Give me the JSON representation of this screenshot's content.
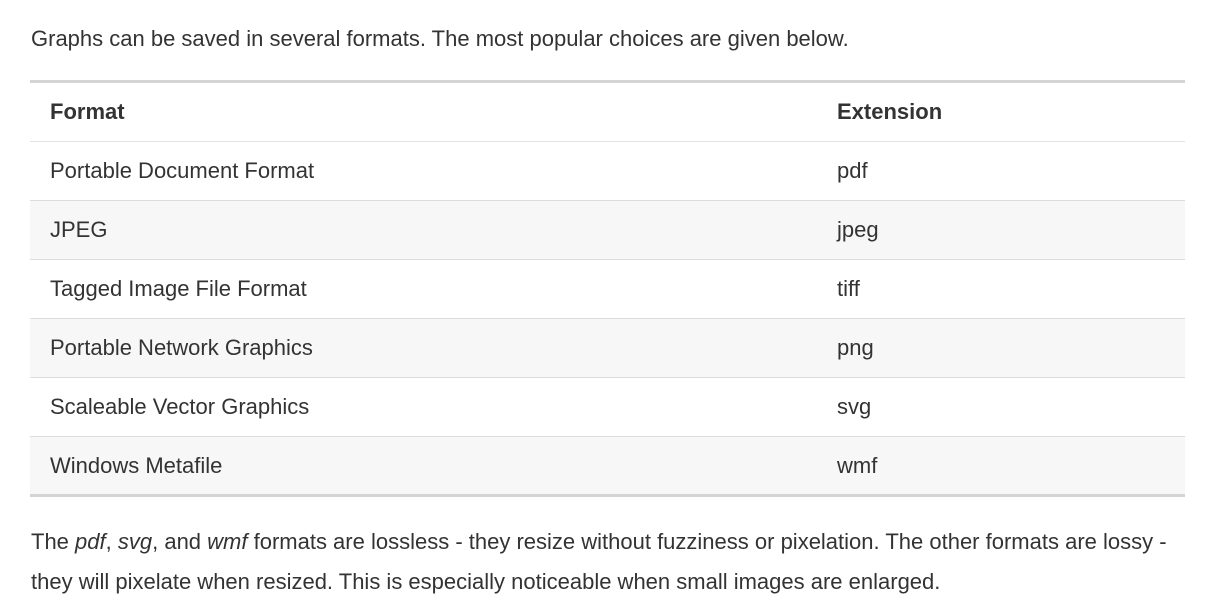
{
  "intro": {
    "text": "Graphs can be saved in several formats. The most popular choices are given below."
  },
  "table": {
    "headers": {
      "format": "Format",
      "extension": "Extension"
    },
    "rows": [
      {
        "format": "Portable Document Format",
        "extension": "pdf"
      },
      {
        "format": "JPEG",
        "extension": "jpeg"
      },
      {
        "format": "Tagged Image File Format",
        "extension": "tiff"
      },
      {
        "format": "Portable Network Graphics",
        "extension": "png"
      },
      {
        "format": "Scaleable Vector Graphics",
        "extension": "svg"
      },
      {
        "format": "Windows Metafile",
        "extension": "wmf"
      }
    ]
  },
  "outro": {
    "part1": "The ",
    "em1": "pdf",
    "part2": ", ",
    "em2": "svg",
    "part3": ", and ",
    "em3": "wmf",
    "part4": " formats are lossless - they resize without fuzziness or pixelation. The other formats are lossy - they will pixelate when resized. This is especially noticeable when small images are enlarged."
  },
  "colors": {
    "text": "#333333",
    "stripe": "#f7f7f7",
    "rule": "#d4d4d4"
  }
}
